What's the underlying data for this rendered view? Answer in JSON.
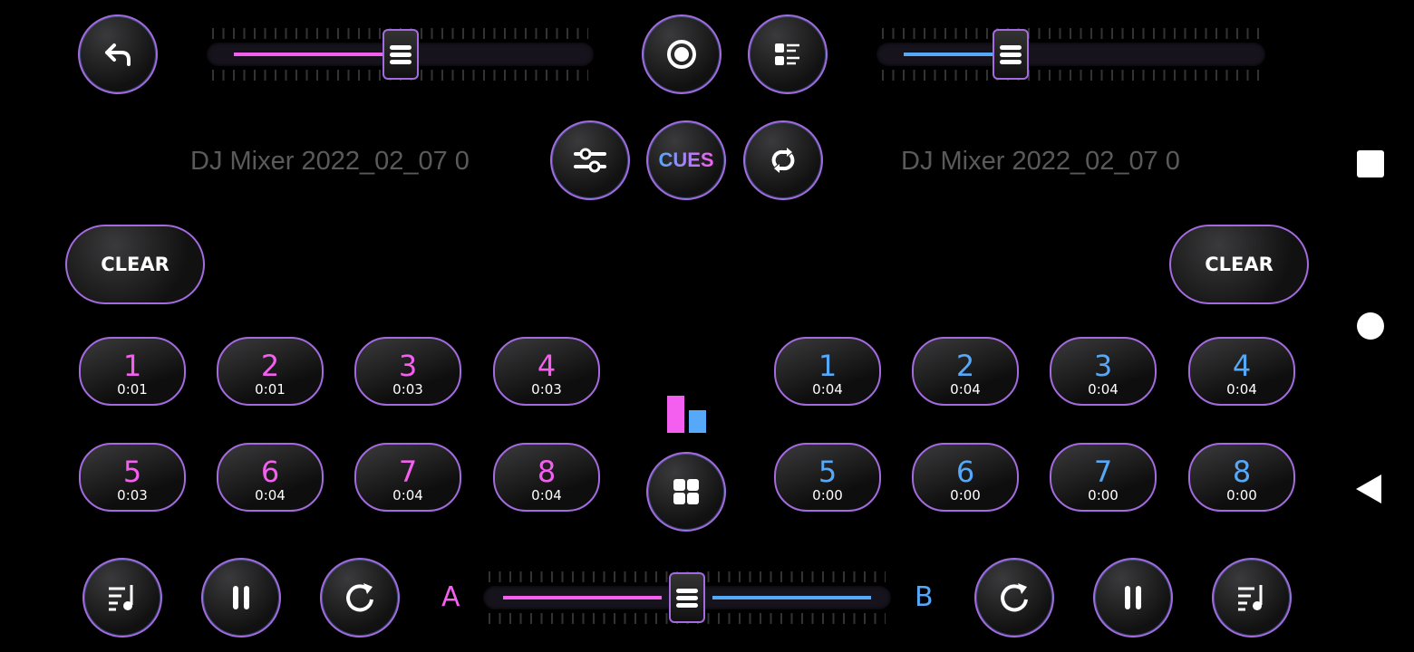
{
  "colors": {
    "deck_a": "#f55ff0",
    "deck_b": "#56a8f8",
    "border": "#a46be0"
  },
  "top": {
    "back_icon": "undo-icon",
    "record_icon": "record-icon",
    "playlist_icon": "list-icon",
    "eq_icon": "sliders-icon",
    "cues_label": "CUES",
    "loop_icon": "repeat-icon"
  },
  "deck_a": {
    "volume": 0.5,
    "title": "DJ Mixer 2022_02_07 0",
    "clear_label": "CLEAR",
    "level": 0.62,
    "pads": [
      {
        "n": "1",
        "t": "0:01"
      },
      {
        "n": "2",
        "t": "0:01"
      },
      {
        "n": "3",
        "t": "0:03"
      },
      {
        "n": "4",
        "t": "0:03"
      },
      {
        "n": "5",
        "t": "0:03"
      },
      {
        "n": "6",
        "t": "0:04"
      },
      {
        "n": "7",
        "t": "0:04"
      },
      {
        "n": "8",
        "t": "0:04"
      }
    ]
  },
  "deck_b": {
    "volume": 0.33,
    "title": "DJ Mixer 2022_02_07 0",
    "clear_label": "CLEAR",
    "level": 0.38,
    "pads": [
      {
        "n": "1",
        "t": "0:04"
      },
      {
        "n": "2",
        "t": "0:04"
      },
      {
        "n": "3",
        "t": "0:04"
      },
      {
        "n": "4",
        "t": "0:04"
      },
      {
        "n": "5",
        "t": "0:00"
      },
      {
        "n": "6",
        "t": "0:00"
      },
      {
        "n": "7",
        "t": "0:00"
      },
      {
        "n": "8",
        "t": "0:00"
      }
    ]
  },
  "crossfader": {
    "value": 0.5,
    "label_a": "A",
    "label_b": "B"
  }
}
